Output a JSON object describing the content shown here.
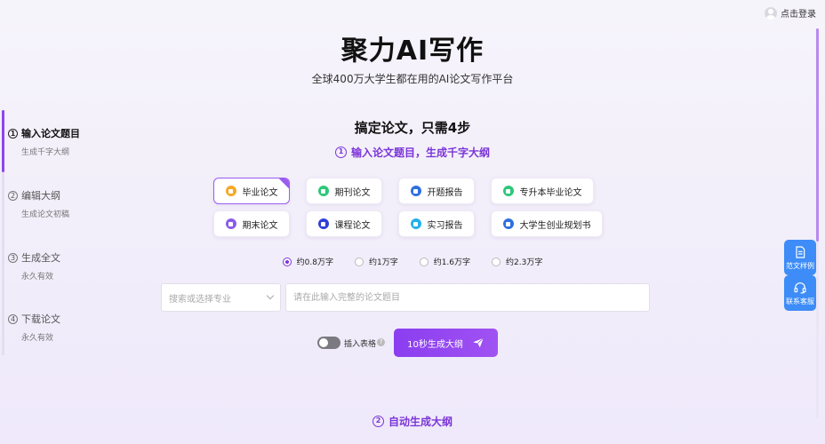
{
  "header": {
    "login_label": "点击登录",
    "title": "聚力AI写作",
    "subtitle": "全球400万大学生都在用的AI论文写作平台"
  },
  "steps": [
    {
      "num": "1",
      "title": "输入论文题目",
      "desc": "生成千字大纲",
      "active": true
    },
    {
      "num": "2",
      "title": "编辑大纲",
      "desc": "生成论文初稿",
      "active": false
    },
    {
      "num": "3",
      "title": "生成全文",
      "desc": "永久有效",
      "active": false
    },
    {
      "num": "4",
      "title": "下载论文",
      "desc": "永久有效",
      "active": false
    }
  ],
  "section": {
    "title": "搞定论文，只需4步",
    "step1_num": "1",
    "step1_label": "输入论文题目，生成千字大纲",
    "step2_num": "2",
    "step2_label": "自动生成大纲"
  },
  "paper_types": [
    {
      "label": "毕业论文",
      "icon": "thesis-icon",
      "color": "#f7a823",
      "selected": true
    },
    {
      "label": "期刊论文",
      "icon": "journal-icon",
      "color": "#2ec77a",
      "selected": false
    },
    {
      "label": "开题报告",
      "icon": "proposal-icon",
      "color": "#2f6fe0",
      "selected": false
    },
    {
      "label": "专升本毕业论文",
      "icon": "upgrade-thesis-icon",
      "color": "#2ec77a",
      "selected": false
    },
    {
      "label": "期末论文",
      "icon": "final-paper-icon",
      "color": "#8b5be8",
      "selected": false
    },
    {
      "label": "课程论文",
      "icon": "course-paper-icon",
      "color": "#2f3fd8",
      "selected": false
    },
    {
      "label": "实习报告",
      "icon": "internship-report-icon",
      "color": "#23b0e8",
      "selected": false
    },
    {
      "label": "大学生创业规划书",
      "icon": "business-plan-icon",
      "color": "#2f6fe0",
      "selected": false
    }
  ],
  "word_counts": [
    {
      "label": "约0.8万字",
      "selected": true
    },
    {
      "label": "约1万字",
      "selected": false
    },
    {
      "label": "约1.6万字",
      "selected": false
    },
    {
      "label": "约2.3万字",
      "selected": false
    }
  ],
  "form": {
    "major_placeholder": "搜索或选择专业",
    "topic_placeholder": "请在此输入完整的论文题目",
    "topic_value": "",
    "table_toggle_label": "插入表格",
    "help_glyph": "?",
    "generate_label": "10秒生成大纲"
  },
  "side_buttons": [
    {
      "label": "范文样例",
      "icon": "document-icon"
    },
    {
      "label": "联系客服",
      "icon": "headset-icon"
    }
  ],
  "colors": {
    "accent": "#8a3ef0",
    "side_button": "#3d8cf7"
  }
}
